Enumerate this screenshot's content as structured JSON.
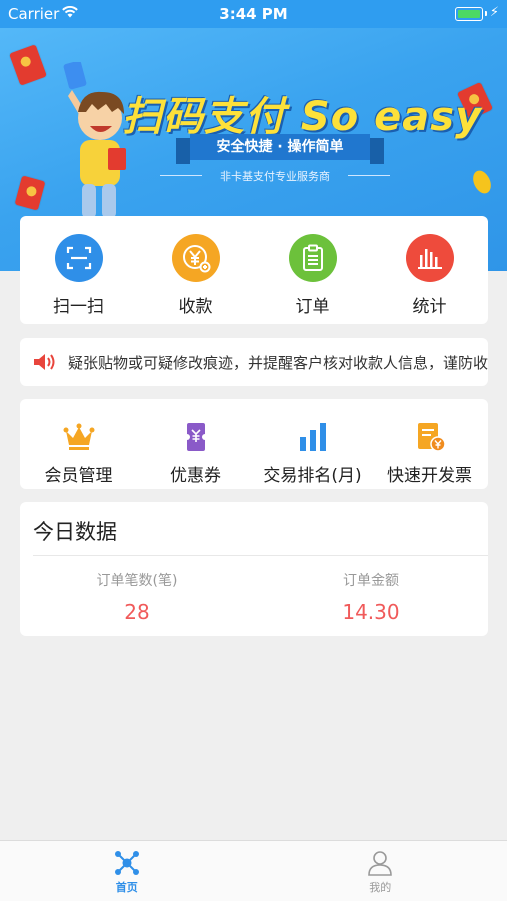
{
  "status_bar": {
    "carrier": "Carrier",
    "time": "3:44 PM"
  },
  "banner": {
    "slogan": "扫码支付 So easy",
    "ribbon": "安全快捷 · 操作简单",
    "subtitle": "非卡基支付专业服务商"
  },
  "main_actions": [
    {
      "label": "扫一扫",
      "icon": "scan-icon",
      "color": "#2f8fe8"
    },
    {
      "label": "收款",
      "icon": "yuan-collect-icon",
      "color": "#f5a623"
    },
    {
      "label": "订单",
      "icon": "clipboard-icon",
      "color": "#6cc13b"
    },
    {
      "label": "统计",
      "icon": "bar-chart-icon",
      "color": "#ee4b3c"
    }
  ],
  "notice": {
    "text": "疑张贴物或可疑修改痕迹，并提醒客户核对收款人信息，谨防收款",
    "icon": "speaker-icon"
  },
  "tools": [
    {
      "label": "会员管理",
      "icon": "crown-icon"
    },
    {
      "label": "优惠券",
      "icon": "coupon-icon"
    },
    {
      "label": "交易排名(月)",
      "icon": "ranking-bars-icon"
    },
    {
      "label": "快速开发票",
      "icon": "invoice-icon"
    }
  ],
  "today": {
    "title": "今日数据",
    "order_count_label": "订单笔数(笔)",
    "order_count_value": "28",
    "order_amount_label": "订单金额",
    "order_amount_value": "14.30"
  },
  "tabbar": [
    {
      "label": "首页",
      "icon": "home-network-icon",
      "active": true,
      "color": "#2f8fe8"
    },
    {
      "label": "我的",
      "icon": "user-icon",
      "active": false,
      "color": "#999999"
    }
  ]
}
